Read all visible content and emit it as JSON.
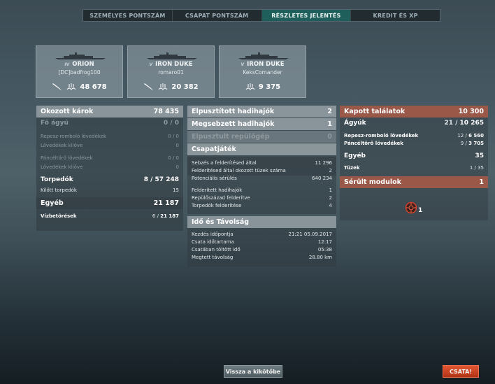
{
  "tabs": [
    "SZEMÉLYES PONTSZÁM",
    "CSAPAT PONTSZÁM",
    "RÉSZLETES JELENTÉS",
    "KREDIT ÉS XP"
  ],
  "cards": [
    {
      "tier": "IV",
      "name": "ORION",
      "player": "[DC]badfrog100",
      "score": "48 678"
    },
    {
      "tier": "V",
      "name": "IRON DUKE",
      "player": "romaro01",
      "score": "20 382"
    },
    {
      "tier": "V",
      "name": "IRON DUKE",
      "player": "KeksComander",
      "score": "9 375"
    }
  ],
  "left": {
    "damage": {
      "label": "Okozott károk",
      "value": "78 435"
    },
    "main": {
      "label": "Fő ágyú",
      "value": "0 / 0"
    },
    "main_rows": [
      {
        "label": "Repesz-romboló lövedékek",
        "value": "0 / 0"
      },
      {
        "label": "Lövedékek kilőve",
        "value": "0"
      },
      {
        "label": "Páncéltörő lövedékek",
        "value": "0 / 0"
      },
      {
        "label": "Lövedékek kilőve",
        "value": "0"
      }
    ],
    "torp": {
      "label": "Torpedók",
      "hits": "8",
      "dmg": "57 248"
    },
    "torp_fired": {
      "label": "Kilőtt torpedók",
      "value": "15"
    },
    "other": {
      "label": "Egyéb",
      "value": "21 187"
    },
    "flood": {
      "label": "Vízbetörések",
      "count": "6",
      "dmg": "21 187"
    }
  },
  "mid": {
    "sunk": {
      "label": "Elpusztított hadihajók",
      "value": "2"
    },
    "burned": {
      "label": "Megsebzett hadihajók",
      "value": "1"
    },
    "planes": {
      "label": "Elpusztult repülőgép",
      "value": "0"
    },
    "team": {
      "label": "Csapatjáték"
    },
    "team_rows": [
      {
        "label": "Sebzés a felderítésed által",
        "value": "11 296"
      },
      {
        "label": "Felderítésed által okozott tüzek száma",
        "value": "2"
      },
      {
        "label": "Potenciális sérülés",
        "value": "640 234"
      },
      {
        "label": "Felderített hadihajók",
        "value": "1"
      },
      {
        "label": "Repülőszázad felderítve",
        "value": "2"
      },
      {
        "label": "Torpedók felderítése",
        "value": "4"
      }
    ],
    "time": {
      "label": "Idő és Távolság"
    },
    "time_rows": [
      {
        "label": "Kezdés időpontja",
        "value": "21:21  05.09.2017"
      },
      {
        "label": "Csata időtartama",
        "value": "12:17"
      },
      {
        "label": "Csatában töltött idő",
        "value": "05:38"
      },
      {
        "label": "Megtett távolság",
        "value": "28.80 km"
      }
    ]
  },
  "right": {
    "received": {
      "label": "Kapott találatok",
      "value": "10 300"
    },
    "guns": {
      "label": "Ágyúk",
      "hits": "21",
      "dmg": "10 265"
    },
    "gun_rows": [
      {
        "label": "Repesz-romboló lövedékek",
        "hits": "12",
        "dmg": "6 560"
      },
      {
        "label": "Páncéltörő lövedékek",
        "hits": "9",
        "dmg": "3 705"
      }
    ],
    "other": {
      "label": "Egyéb",
      "value": "35"
    },
    "fires": {
      "label": "Tüzek",
      "value": "1 / 35"
    },
    "modules": {
      "label": "Sérült modulok",
      "value": "1"
    },
    "module_count": "1"
  },
  "buttons": {
    "port": "Vissza a kikötőbe",
    "battle": "CSATA!"
  },
  "colors": {
    "active_tab": "#1e5f5c",
    "red_header": "#aa5a46",
    "battle_button": "#c83a1c"
  }
}
